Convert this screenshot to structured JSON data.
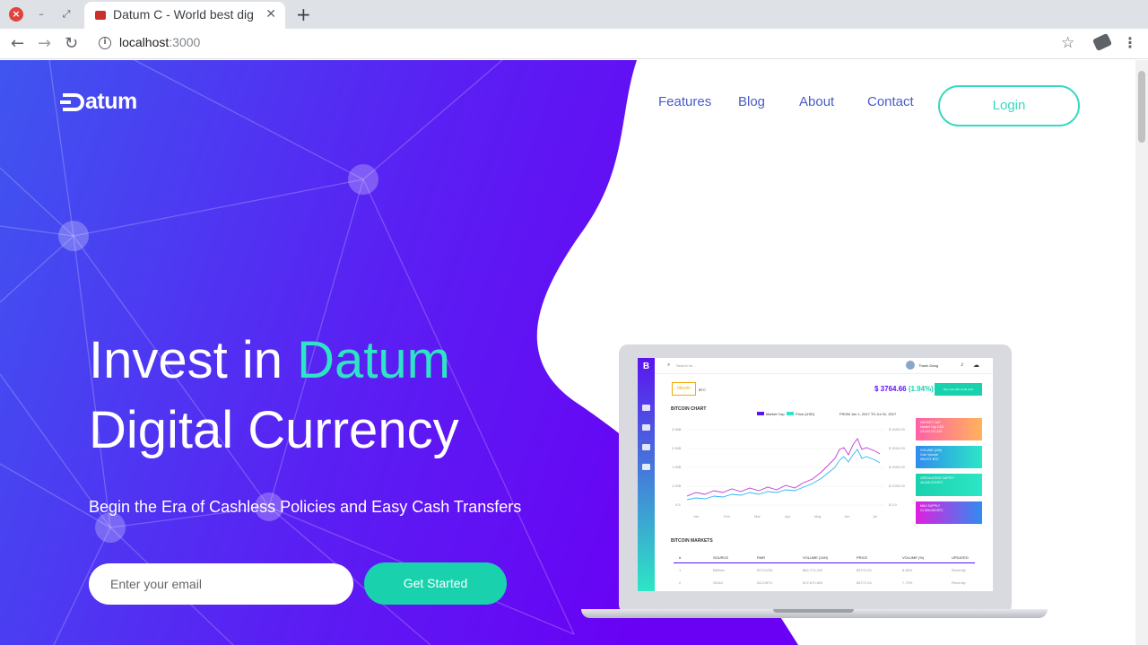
{
  "browser": {
    "tab_title": "Datum C - World best dig",
    "tab_close": "✕",
    "new_tab": "+",
    "url_host": "localhost",
    "url_port": ":3000",
    "icons": [
      "close-window-icon",
      "minimize-icon",
      "restore-icon",
      "back-icon",
      "forward-icon",
      "reload-icon",
      "info-icon",
      "star-icon",
      "extension-icon",
      "menu-icon"
    ]
  },
  "site": {
    "logo_text": "atum",
    "nav": [
      "Features",
      "Blog",
      "About",
      "Contact"
    ],
    "login_label": "Login",
    "headline_part1": "Invest in ",
    "headline_accent": "Datum",
    "headline_line2": "Digital Currency",
    "subheadline": "Begin the Era of Cashless Policies and Easy Cash Transfers",
    "email_placeholder": "Enter your email",
    "cta_label": "Get Started",
    "colors": {
      "accent": "#2fe3c6",
      "nav_text": "#4a5cc9",
      "cta": "#19d1ad",
      "hero_start": "#3f55f0",
      "hero_end": "#6a00f4"
    }
  },
  "dashboard": {
    "search_placeholder": "Search for...",
    "user_name": "Thanh Dang",
    "coin_badge": "bitcoin",
    "coin_symbol": "BTC",
    "price": "$ 3764.66",
    "change": "(1.94%)",
    "top_button": "Buy now with credit card",
    "chart_title": "BITCOIN CHART",
    "legend_1": "Market Cap",
    "legend_2": "Price (USD)",
    "date_range": "FROM  Jun 1, 2017  TO  Jul 31, 2017",
    "y_left": [
      "3.96B",
      "2.96B",
      "1.96B",
      "1.00B",
      "0.5"
    ],
    "y_right": [
      "$ 4000.00",
      "$ 3000.00",
      "$ 2000.00",
      "$ 1000.00",
      "$ 0.0"
    ],
    "x_ticks": [
      "Jan",
      "Feb",
      "Mar",
      "Apr",
      "May",
      "Jun",
      "Jul"
    ],
    "cards": [
      {
        "title": "MARKET CAP",
        "line1": "Market Cap USD",
        "line2": "13,340,187,425"
      },
      {
        "title": "VOLUME (24h)",
        "line1": "Coin Volume",
        "line2": "999,971 BTC"
      },
      {
        "title": "CIRCULATING SUPPLY",
        "line1": "16,449,375 BTC",
        "line2": ""
      },
      {
        "title": "MAX SUPPLY",
        "line1": "21,000,000 BTC",
        "line2": ""
      }
    ],
    "markets_title": "BITCOIN MARKETS",
    "table_headers": [
      "#",
      "SOURCE",
      "PAIR",
      "VOLUME (24H)",
      "PRICE",
      "VOLUME (%)",
      "UPDATED"
    ],
    "table_rows": [
      [
        "1",
        "Bitfinex",
        "BTC/USD",
        "$82,774,200",
        "$3770.00",
        "8.88%",
        "Recently"
      ],
      [
        "2",
        "GDAX",
        "BCC/BTC",
        "$72,670,800",
        "$3772.04",
        "7.79%",
        "Recently"
      ]
    ]
  }
}
